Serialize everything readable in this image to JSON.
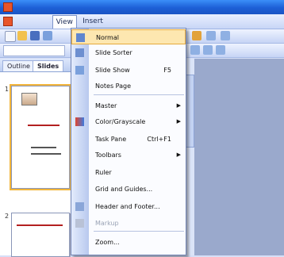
{
  "window": {
    "title": "",
    "icon": "powerpoint-icon"
  },
  "menubar": {
    "items": [
      {
        "label": "",
        "open": false
      },
      {
        "label": "",
        "open": false
      },
      {
        "label": "View",
        "open": true
      },
      {
        "label": "Insert",
        "open": false
      },
      {
        "label": "",
        "open": false
      },
      {
        "label": "",
        "open": false
      },
      {
        "label": "",
        "open": false
      },
      {
        "label": "",
        "open": false
      },
      {
        "label": "",
        "open": false
      }
    ]
  },
  "left_pane": {
    "tabs": [
      {
        "label": "Outline"
      },
      {
        "label": "Slides"
      }
    ],
    "slides": [
      {
        "number": "1",
        "text": "",
        "selected": true
      },
      {
        "number": "2",
        "text": "",
        "selected": false
      }
    ]
  },
  "view_menu": {
    "items": [
      {
        "label": "Normal",
        "shortcut": "",
        "submenu": false,
        "icon": "normal-view-icon",
        "highlight": true,
        "disabled": false
      },
      {
        "label": "Slide Sorter",
        "shortcut": "",
        "submenu": false,
        "icon": "slide-sorter-icon",
        "highlight": false,
        "disabled": false
      },
      {
        "label": "Slide Show",
        "shortcut": "F5",
        "submenu": false,
        "icon": "slide-show-icon",
        "highlight": false,
        "disabled": false
      },
      {
        "label": "Notes Page",
        "shortcut": "",
        "submenu": false,
        "icon": "",
        "highlight": false,
        "disabled": false
      },
      {
        "label": "Master",
        "shortcut": "",
        "submenu": true,
        "icon": "",
        "highlight": false,
        "disabled": false
      },
      {
        "label": "Color/Grayscale",
        "shortcut": "",
        "submenu": true,
        "icon": "color-grayscale-icon",
        "highlight": false,
        "disabled": false
      },
      {
        "label": "Task Pane",
        "shortcut": "Ctrl+F1",
        "submenu": false,
        "icon": "",
        "highlight": false,
        "disabled": false
      },
      {
        "label": "Toolbars",
        "shortcut": "",
        "submenu": true,
        "icon": "",
        "highlight": false,
        "disabled": false
      },
      {
        "label": "Ruler",
        "shortcut": "",
        "submenu": false,
        "icon": "",
        "highlight": false,
        "disabled": false
      },
      {
        "label": "Grid and Guides...",
        "shortcut": "",
        "submenu": false,
        "icon": "",
        "highlight": false,
        "disabled": false
      },
      {
        "label": "Header and Footer...",
        "shortcut": "",
        "submenu": false,
        "icon": "header-footer-icon",
        "highlight": false,
        "disabled": false
      },
      {
        "label": "Markup",
        "shortcut": "",
        "submenu": false,
        "icon": "markup-icon",
        "highlight": false,
        "disabled": true
      },
      {
        "label": "Zoom...",
        "shortcut": "",
        "submenu": false,
        "icon": "",
        "highlight": false,
        "disabled": false
      }
    ]
  },
  "colors": {
    "title_bar": "#1d5fd6",
    "menu_highlight": "#fde7b0",
    "gutter": "#b8c9ee",
    "workspace": "#9aa9cc"
  }
}
